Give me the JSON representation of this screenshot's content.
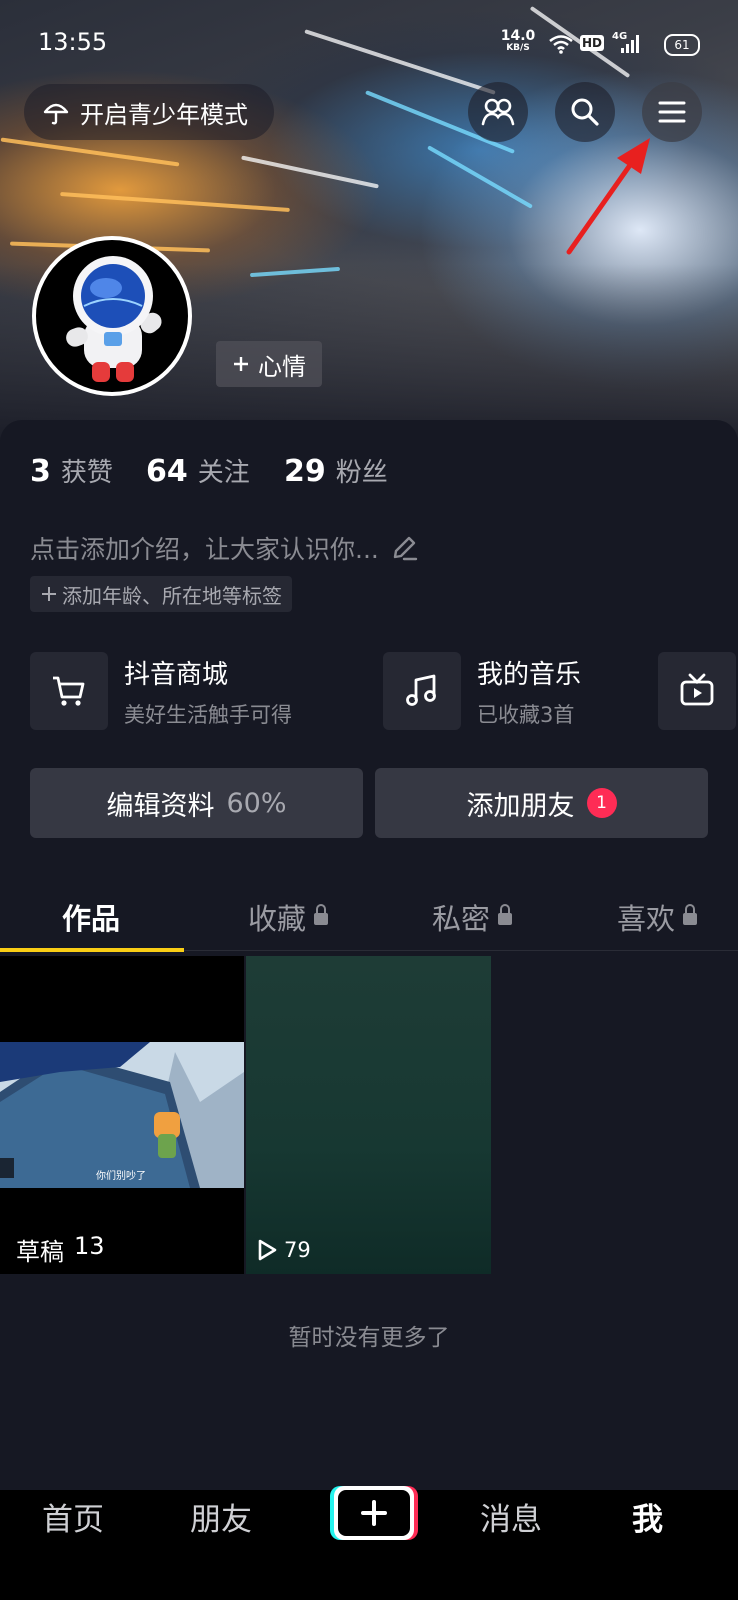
{
  "status_bar": {
    "time": "13:55",
    "speed": "14.0",
    "speed_unit": "KB/S",
    "hd": "HD",
    "net": "4G",
    "battery": "61"
  },
  "header": {
    "youth_mode_label": "开启青少年模式",
    "mood_label": "心情"
  },
  "icons": {
    "youth": "umbrella-icon",
    "friends": "friends-icon",
    "search": "search-icon",
    "menu": "menu-icon"
  },
  "stats": [
    {
      "value": "3",
      "label": "获赞"
    },
    {
      "value": "64",
      "label": "关注"
    },
    {
      "value": "29",
      "label": "粉丝"
    }
  ],
  "bio": {
    "placeholder": "点击添加介绍，让大家认识你...",
    "tags_label": "添加年龄、所在地等标签"
  },
  "services": [
    {
      "title": "抖音商城",
      "subtitle": "美好生活触手可得",
      "icon": "cart-icon"
    },
    {
      "title": "我的音乐",
      "subtitle": "已收藏3首",
      "icon": "music-note-icon"
    },
    {
      "icon": "tv-icon"
    }
  ],
  "actions": {
    "edit_profile": "编辑资料",
    "edit_progress": "60%",
    "add_friend": "添加朋友",
    "add_friend_badge": "1"
  },
  "tabs": [
    {
      "label": "作品",
      "active": true
    },
    {
      "label": "收藏",
      "locked": true
    },
    {
      "label": "私密",
      "locked": true
    },
    {
      "label": "喜欢",
      "locked": true
    }
  ],
  "videos": [
    {
      "label": "草稿",
      "count": "13",
      "caption": "你们别吵了"
    },
    {
      "play_count": "79"
    }
  ],
  "empty_text": "暂时没有更多了",
  "bottom_nav": {
    "home": "首页",
    "friends": "朋友",
    "messages": "消息",
    "me": "我"
  },
  "colors": {
    "background": "#161823",
    "accent": "#fe2c55",
    "tab_indicator": "#face15"
  }
}
